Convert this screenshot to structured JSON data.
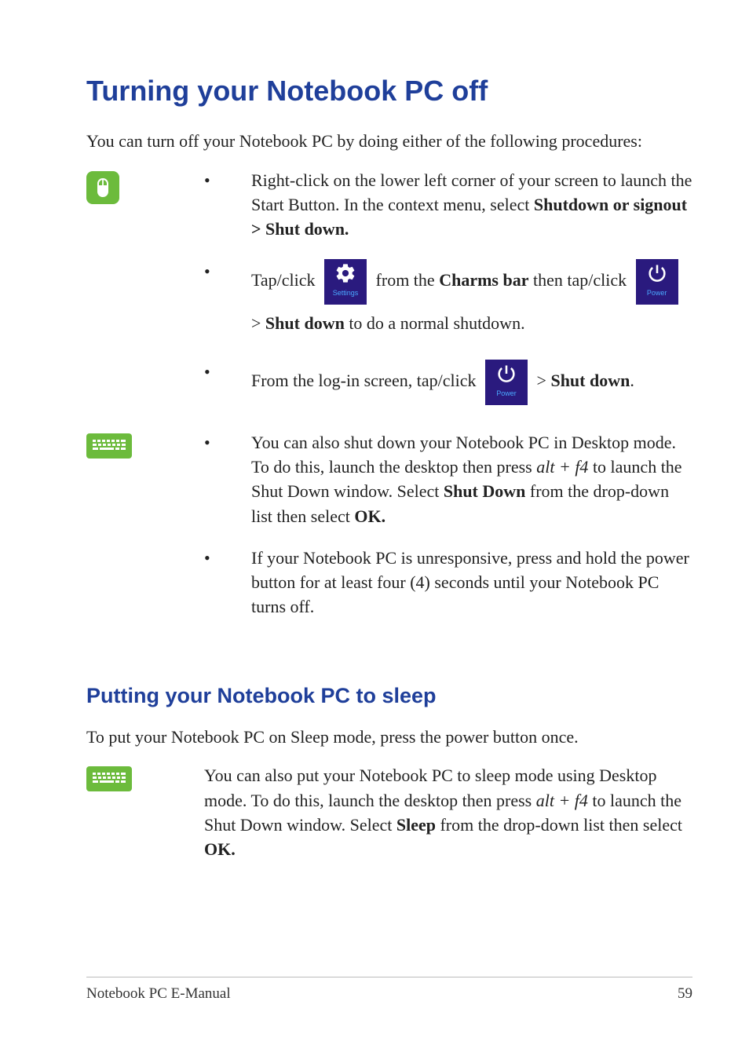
{
  "heading": "Turning your Notebook PC off",
  "intro": "You can turn off your Notebook PC by doing either of the following procedures:",
  "mouse_section": {
    "items": [
      {
        "pre": "Right-click on the lower left corner of your screen to launch the Start Button. In the context menu, select ",
        "bold": "Shutdown or signout > Shut down."
      },
      {
        "p1a": "Tap/click ",
        "tile1_label": "Settings",
        "p1b": " from  the ",
        "p1bold": "Charms bar",
        "p1c": " then tap/click ",
        "tile2_label": "Power",
        "p1d": " > ",
        "p1bold2": "Shut down",
        "p1e": " to do a normal shutdown."
      },
      {
        "p2a": "From the log-in screen, tap/click ",
        "tile3_label": "Power",
        "p2b": " > ",
        "p2bold": "Shut down",
        "p2c": "."
      }
    ]
  },
  "keyboard_section": {
    "items": [
      {
        "a": "You can also shut down your Notebook PC in Desktop mode. To do this, launch the desktop then press ",
        "key": "alt + f4",
        "b": " to launch the Shut Down window. Select ",
        "bold1": "Shut Down",
        "c": " from the drop-down list then select ",
        "bold2": "OK."
      },
      {
        "text": "If your Notebook PC is unresponsive, press and hold the power button for at least four (4) seconds until your Notebook PC turns off."
      }
    ]
  },
  "sleep_heading": "Putting your Notebook PC to sleep",
  "sleep_intro": "To put your Notebook PC on Sleep mode, press the power button once.",
  "sleep_row": {
    "a": "You can also put your Notebook PC to sleep mode using Desktop mode. To do this, launch the desktop then press ",
    "key": "alt + f4",
    "b": " to launch the Shut Down window. Select ",
    "bold1": "Sleep",
    "c": " from the drop-down list then select ",
    "bold2": "OK."
  },
  "footer_left": "Notebook PC E-Manual",
  "footer_right": "59"
}
